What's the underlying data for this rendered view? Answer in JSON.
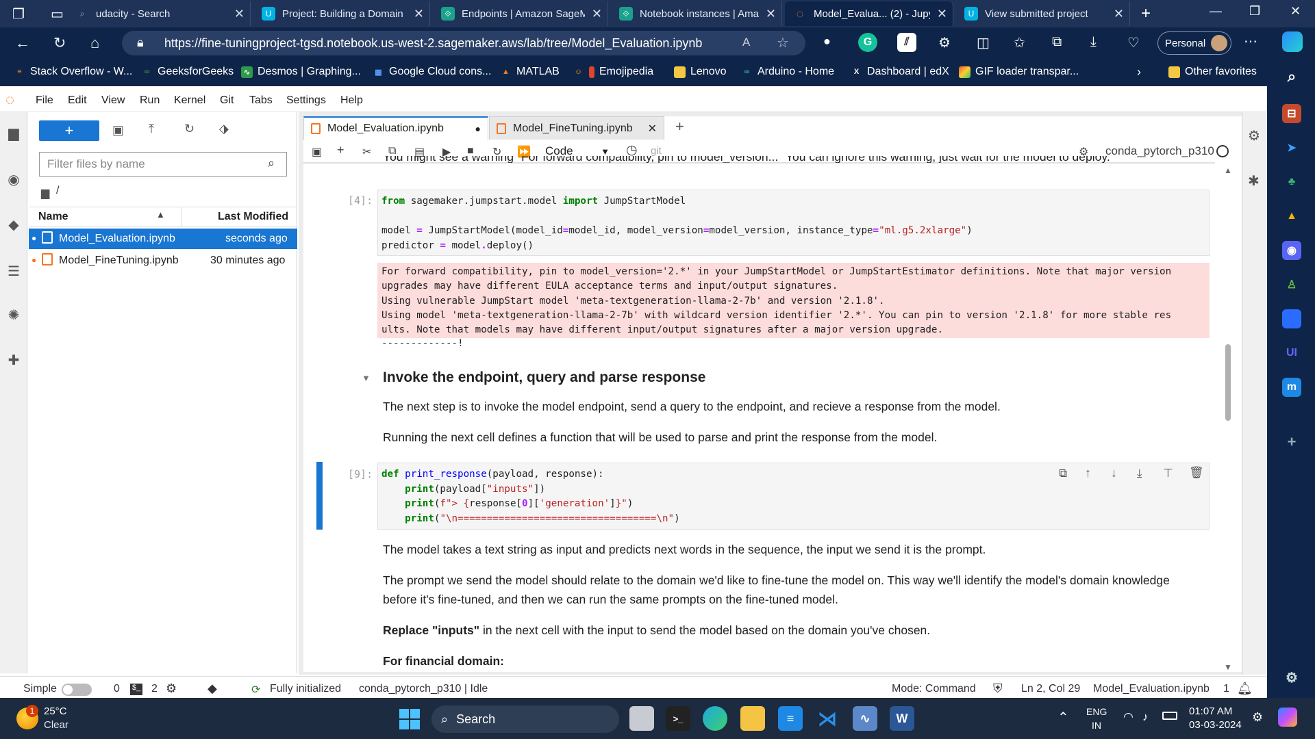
{
  "browser": {
    "tabs": [
      {
        "title": "udacity - Search"
      },
      {
        "title": "Project: Building a Domain"
      },
      {
        "title": "Endpoints | Amazon SageM"
      },
      {
        "title": "Notebook instances | Ama"
      },
      {
        "title": "Model_Evalua... (2) - Jupyt"
      },
      {
        "title": "View submitted project"
      }
    ],
    "url": "https://fine-tuningproject-tgsd.notebook.us-west-2.sagemaker.aws/lab/tree/Model_Evaluation.ipynb",
    "profile_label": "Personal",
    "bookmarks": [
      "Stack Overflow - W...",
      "GeeksforGeeks",
      "Desmos | Graphing...",
      "Google Cloud cons...",
      "MATLAB",
      "Emojipedia",
      "Lenovo",
      "Arduino - Home",
      "Dashboard | edX",
      "GIF loader transpar..."
    ],
    "other_favorites": "Other favorites"
  },
  "jupyter": {
    "menu": [
      "File",
      "Edit",
      "View",
      "Run",
      "Kernel",
      "Git",
      "Tabs",
      "Settings",
      "Help"
    ],
    "file_browser": {
      "filter_placeholder": "Filter files by name",
      "path": "/",
      "col_name": "Name",
      "col_modified": "Last Modified",
      "files": [
        {
          "name": "Model_Evaluation.ipynb",
          "modified": "seconds ago",
          "selected": true
        },
        {
          "name": "Model_FineTuning.ipynb",
          "modified": "30 minutes ago",
          "selected": false
        }
      ]
    },
    "tabs": [
      "Model_Evaluation.ipynb",
      "Model_FineTuning.ipynb"
    ],
    "toolbar": {
      "cell_type": "Code",
      "git": "git",
      "kernel": "conda_pytorch_p310"
    },
    "cells": {
      "top_text": "You might see a warning \"For forward compatibility, pin to model_version...\" You can ignore this warning, just wait for the model to deploy.",
      "cell4_prompt": "[4]:",
      "cell9_prompt": "[9]:",
      "error_lines": [
        "For forward compatibility, pin to model_version='2.*' in your JumpStartModel or JumpStartEstimator definitions. Note that major version",
        "upgrades may have different EULA acceptance terms and input/output signatures.",
        "Using vulnerable JumpStart model 'meta-textgeneration-llama-2-7b' and version '2.1.8'.",
        "Using model 'meta-textgeneration-llama-2-7b' with wildcard version identifier '2.*'. You can pin to version '2.1.8' for more stable res",
        "ults. Note that models may have different input/output signatures after a major version upgrade.",
        "-------------!"
      ],
      "heading": "Invoke the endpoint, query and parse response",
      "p1": "The next step is to invoke the model endpoint, send a query to the endpoint, and recieve a response from the model.",
      "p2": "Running the next cell defines a function that will be used to parse and print the response from the model.",
      "p3": "The model takes a text string as input and predicts next words in the sequence, the input we send it is the prompt.",
      "p4a": "The prompt we send the model should relate to the domain we'd like to fine-tune the model on. This way we'll identify the model's domain knowledge",
      "p4b": "before it's fine-tuned, and then we can run the same prompts on the fine-tuned model.",
      "p5_bold": "Replace \"inputs\"",
      "p5_rest": " in the next cell with the input to send the model based on the domain you've chosen.",
      "p6": "For financial domain:"
    },
    "status": {
      "simple": "Simple",
      "count0": "0",
      "count2": "2",
      "initialized": "Fully initialized",
      "kernel_state": "conda_pytorch_p310 | Idle",
      "mode": "Mode: Command",
      "position": "Ln 2, Col 29",
      "file": "Model_Evaluation.ipynb",
      "notifications": "1"
    }
  },
  "taskbar": {
    "weather_temp": "25°C",
    "weather_desc": "Clear",
    "weather_badge": "1",
    "search": "Search",
    "lang1": "ENG",
    "lang2": "IN",
    "time": "01:07 AM",
    "date": "03-03-2024"
  },
  "colors": {
    "jupyter_accent": "#1976d2",
    "browser_bg": "#0e2549",
    "error_bg": "#fddcdc"
  }
}
